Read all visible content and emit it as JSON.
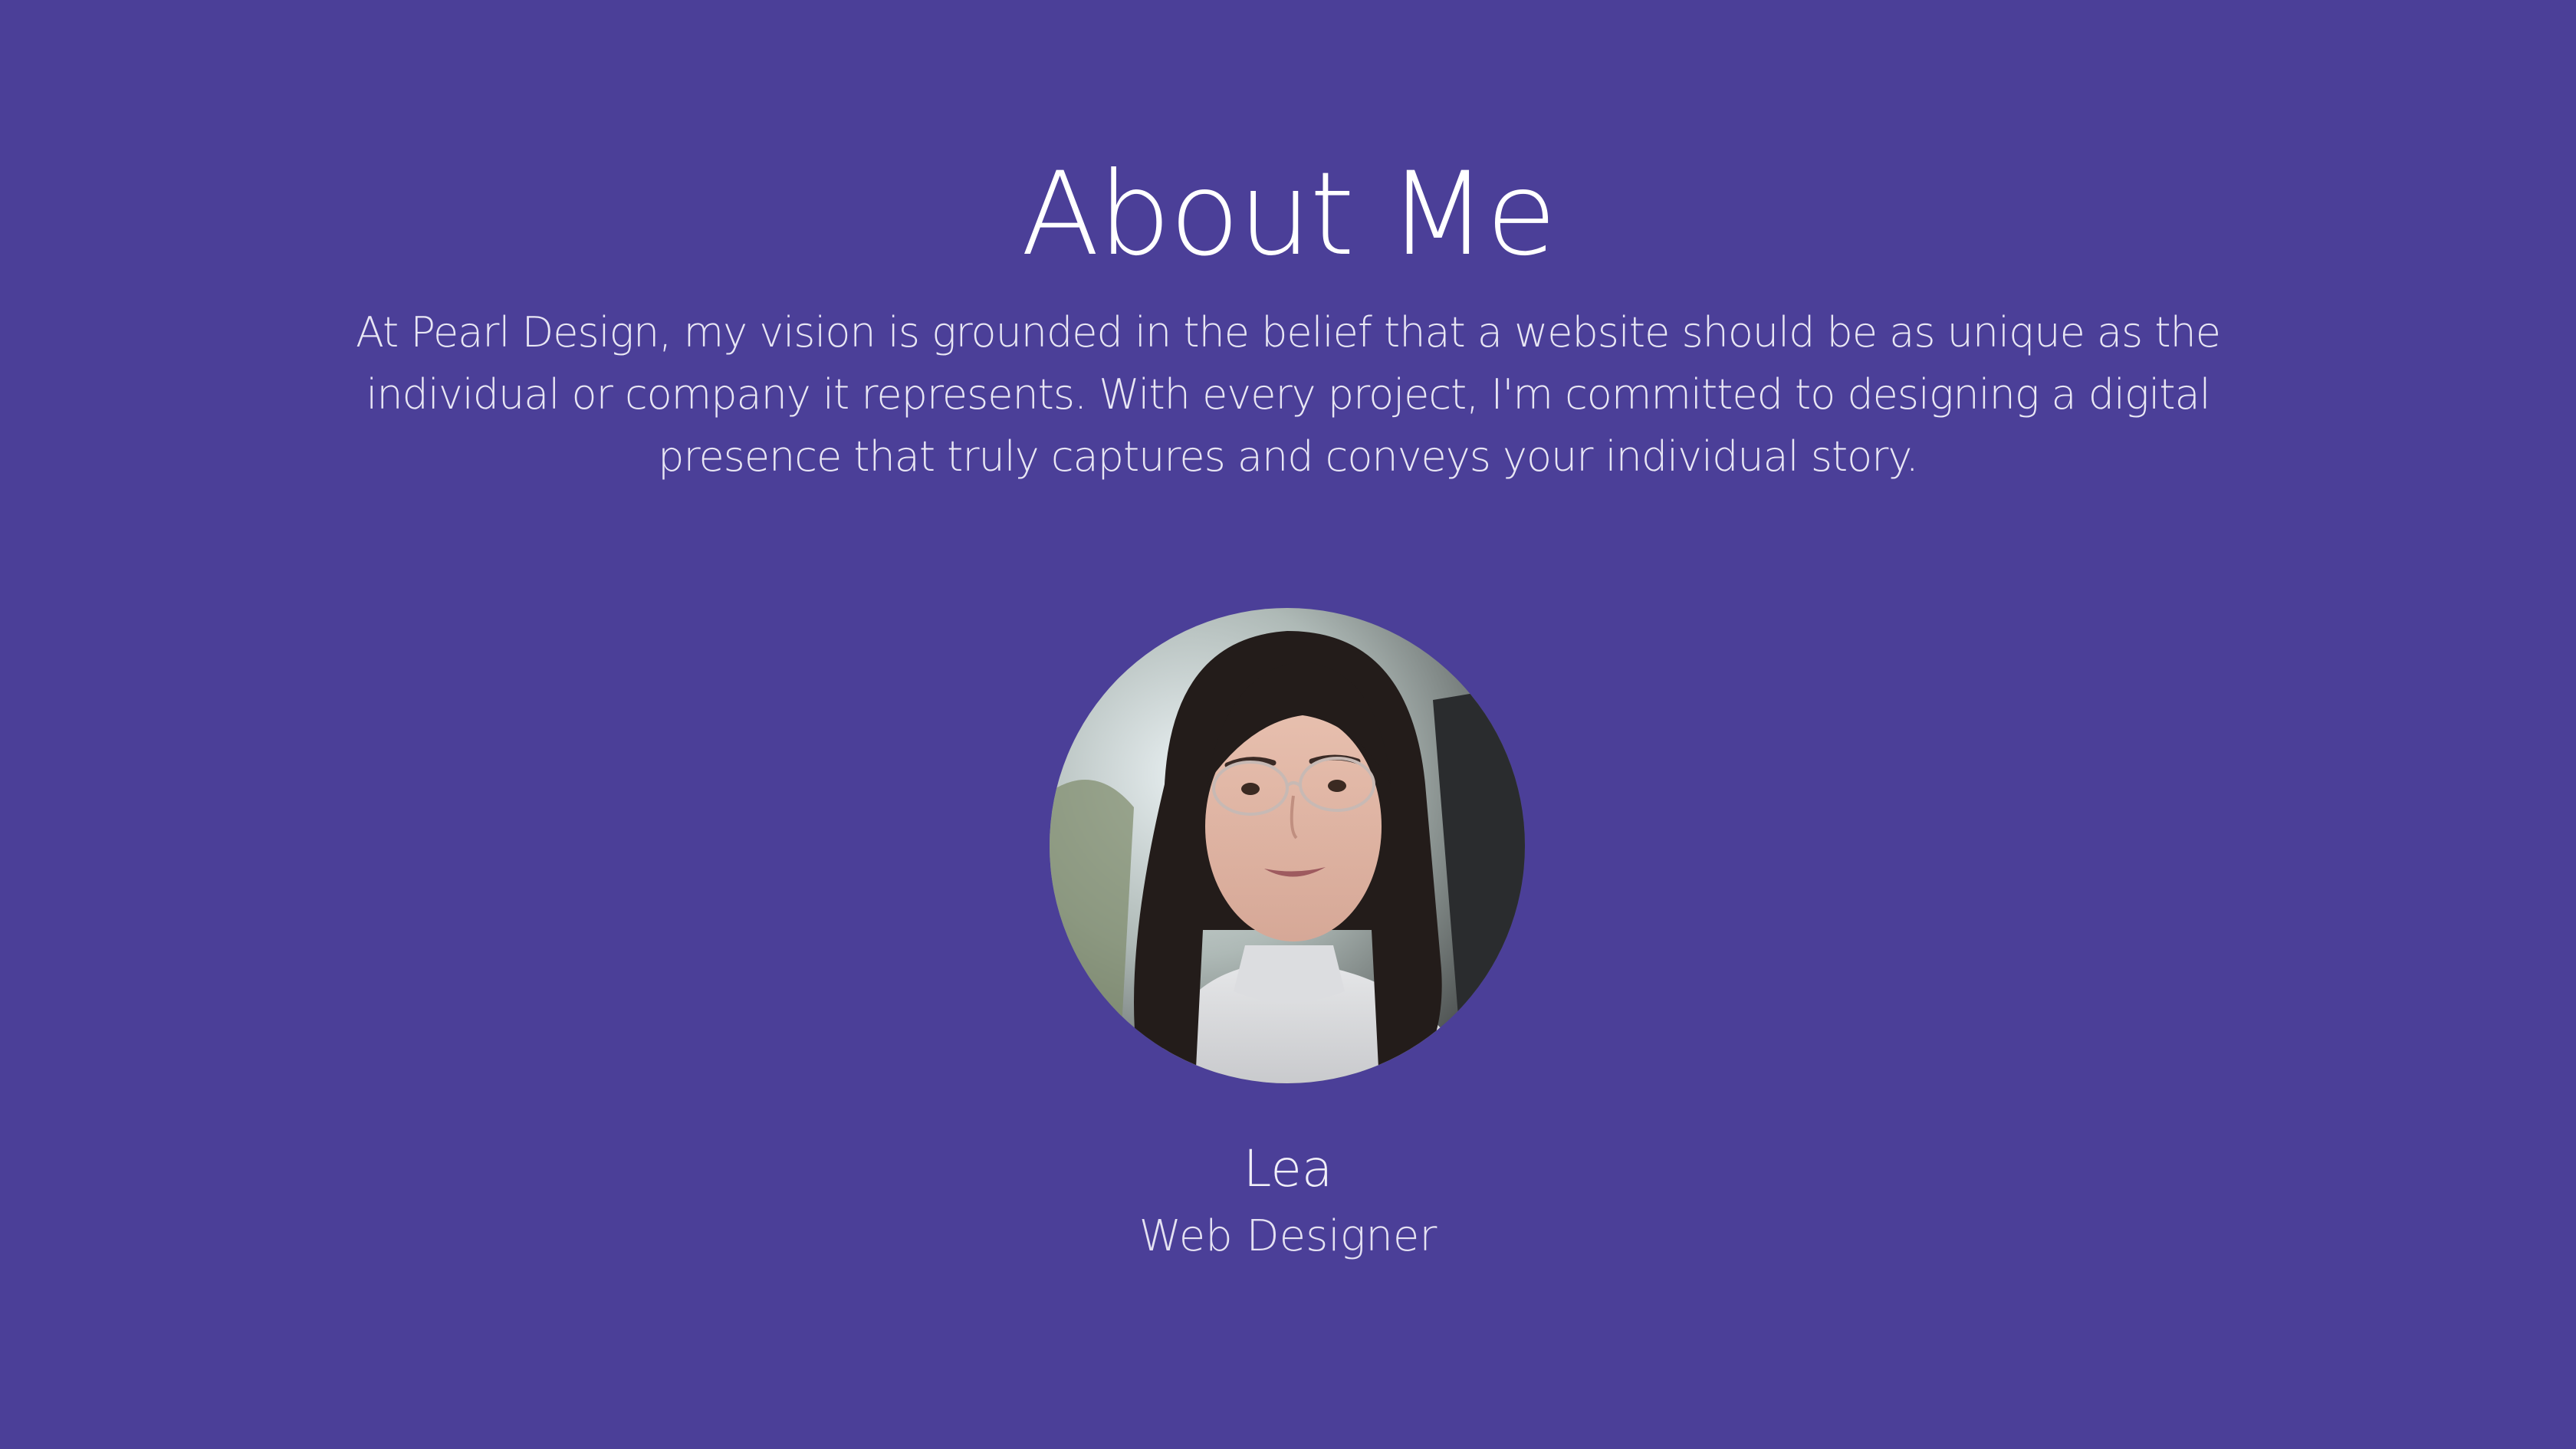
{
  "about": {
    "heading": "About Me",
    "intro": "At Pearl Design, my vision is grounded in the belief that a website should be as unique as the individual or company it represents. With every project, I'm committed to designing a digital presence that truly captures and conveys your individual story."
  },
  "profile": {
    "name": "Lea",
    "role": "Web Designer",
    "photo_icon": "profile-photo"
  },
  "colors": {
    "background": "#4b3f98",
    "text": "#ffffff"
  }
}
